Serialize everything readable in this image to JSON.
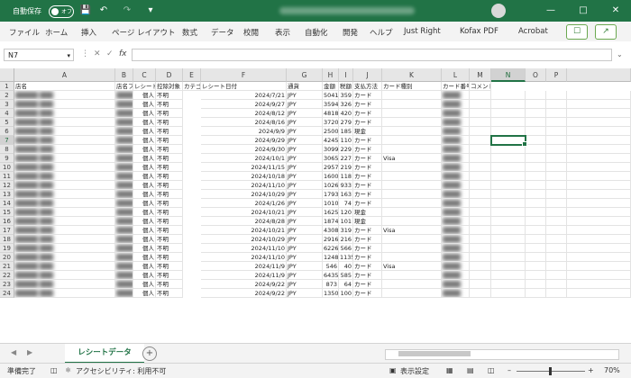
{
  "titlebar": {
    "autosave_label": "自動保存",
    "autosave_state": "オフ",
    "icons": [
      "save-icon",
      "undo-icon",
      "redo-icon",
      "customize-icon"
    ],
    "window_controls": [
      "minimize-icon",
      "restore-icon",
      "close-icon"
    ]
  },
  "ribbon": {
    "tabs": [
      "ファイル",
      "ホーム",
      "挿入",
      "ページ レイアウト",
      "数式",
      "データ",
      "校閲",
      "表示",
      "自動化",
      "開発",
      "ヘルプ",
      "Just Right",
      "Kofax PDF",
      "Acrobat"
    ]
  },
  "formula_bar": {
    "name_box": "N7",
    "cancel": "✕",
    "enter": "✓",
    "fx": "fx",
    "formula": ""
  },
  "sheet": {
    "columns": [
      "A",
      "B",
      "C",
      "D",
      "E",
      "F",
      "G",
      "H",
      "I",
      "J",
      "K",
      "L",
      "M",
      "N",
      "O",
      "P"
    ],
    "selected_column": "N",
    "selected_row": "7",
    "headers": [
      "店名",
      "店名フリガナ",
      "レシート区分",
      "控除対象",
      "カテゴリー",
      "レシート日付",
      "通貨",
      "金額",
      "税額",
      "支払方法",
      "カード種別",
      "カード番号",
      "コメント"
    ],
    "rows": [
      {
        "n": "2",
        "c": "個人",
        "d": "不明",
        "f": "2024/7/21",
        "g": "JPY",
        "h": "5041",
        "i": "359",
        "j": "カード",
        "k": ""
      },
      {
        "n": "3",
        "c": "個人",
        "d": "不明",
        "f": "2024/9/27",
        "g": "JPY",
        "h": "3594",
        "i": "326",
        "j": "カード",
        "k": ""
      },
      {
        "n": "4",
        "c": "個人",
        "d": "不明",
        "f": "2024/8/12",
        "g": "JPY",
        "h": "4818",
        "i": "420",
        "j": "カード",
        "k": ""
      },
      {
        "n": "5",
        "c": "個人",
        "d": "不明",
        "f": "2024/8/16",
        "g": "JPY",
        "h": "3720",
        "i": "279",
        "j": "カード",
        "k": ""
      },
      {
        "n": "6",
        "c": "個人",
        "d": "不明",
        "f": "2024/9/9",
        "g": "JPY",
        "h": "2500",
        "i": "185",
        "j": "現金",
        "k": ""
      },
      {
        "n": "7",
        "c": "個人",
        "d": "不明",
        "f": "2024/9/29",
        "g": "JPY",
        "h": "4245",
        "i": "110",
        "j": "カード",
        "k": ""
      },
      {
        "n": "8",
        "c": "個人",
        "d": "不明",
        "f": "2024/9/30",
        "g": "JPY",
        "h": "3099",
        "i": "229",
        "j": "カード",
        "k": ""
      },
      {
        "n": "9",
        "c": "個人",
        "d": "不明",
        "f": "2024/10/1",
        "g": "JPY",
        "h": "3065",
        "i": "227",
        "j": "カード",
        "k": "Visa"
      },
      {
        "n": "10",
        "c": "個人",
        "d": "不明",
        "f": "2024/11/15",
        "g": "JPY",
        "h": "2957",
        "i": "219",
        "j": "カード",
        "k": ""
      },
      {
        "n": "11",
        "c": "個人",
        "d": "不明",
        "f": "2024/10/18",
        "g": "JPY",
        "h": "1600",
        "i": "118",
        "j": "カード",
        "k": ""
      },
      {
        "n": "12",
        "c": "個人",
        "d": "不明",
        "f": "2024/11/10",
        "g": "JPY",
        "h": "10263",
        "i": "933",
        "j": "カード",
        "k": ""
      },
      {
        "n": "13",
        "c": "個人",
        "d": "不明",
        "f": "2024/10/29",
        "g": "JPY",
        "h": "1793",
        "i": "163",
        "j": "カード",
        "k": ""
      },
      {
        "n": "14",
        "c": "個人",
        "d": "不明",
        "f": "2024/1/26",
        "g": "JPY",
        "h": "1010",
        "i": "74",
        "j": "カード",
        "k": ""
      },
      {
        "n": "15",
        "c": "個人",
        "d": "不明",
        "f": "2024/10/21",
        "g": "JPY",
        "h": "1625",
        "i": "120",
        "j": "現金",
        "k": ""
      },
      {
        "n": "16",
        "c": "個人",
        "d": "不明",
        "f": "2024/8/28",
        "g": "JPY",
        "h": "1874",
        "i": "101",
        "j": "現金",
        "k": ""
      },
      {
        "n": "17",
        "c": "個人",
        "d": "不明",
        "f": "2024/10/21",
        "g": "JPY",
        "h": "4308",
        "i": "319",
        "j": "カード",
        "k": "Visa"
      },
      {
        "n": "18",
        "c": "個人",
        "d": "不明",
        "f": "2024/10/29",
        "g": "JPY",
        "h": "2916",
        "i": "216",
        "j": "カード",
        "k": ""
      },
      {
        "n": "19",
        "c": "個人",
        "d": "不明",
        "f": "2024/11/10",
        "g": "JPY",
        "h": "6226",
        "i": "566",
        "j": "カード",
        "k": ""
      },
      {
        "n": "20",
        "c": "個人",
        "d": "不明",
        "f": "2024/11/10",
        "g": "JPY",
        "h": "12488",
        "i": "1135",
        "j": "カード",
        "k": ""
      },
      {
        "n": "21",
        "c": "個人",
        "d": "不明",
        "f": "2024/11/9",
        "g": "JPY",
        "h": "546",
        "i": "40",
        "j": "カード",
        "k": "Visa"
      },
      {
        "n": "22",
        "c": "個人",
        "d": "不明",
        "f": "2024/11/9",
        "g": "JPY",
        "h": "6435",
        "i": "585",
        "j": "カード",
        "k": ""
      },
      {
        "n": "23",
        "c": "個人",
        "d": "不明",
        "f": "2024/9/22",
        "g": "JPY",
        "h": "873",
        "i": "64",
        "j": "カード",
        "k": ""
      },
      {
        "n": "24",
        "c": "個人",
        "d": "不明",
        "f": "2024/9/22",
        "g": "JPY",
        "h": "1350",
        "i": "100",
        "j": "カード",
        "k": ""
      }
    ],
    "tab": "レシートデータ"
  },
  "statusbar": {
    "ready": "準備完了",
    "accessibility": "アクセシビリティ: 利用不可",
    "display_settings": "表示設定",
    "zoom": "70%"
  },
  "colors": {
    "accent": "#217346"
  }
}
